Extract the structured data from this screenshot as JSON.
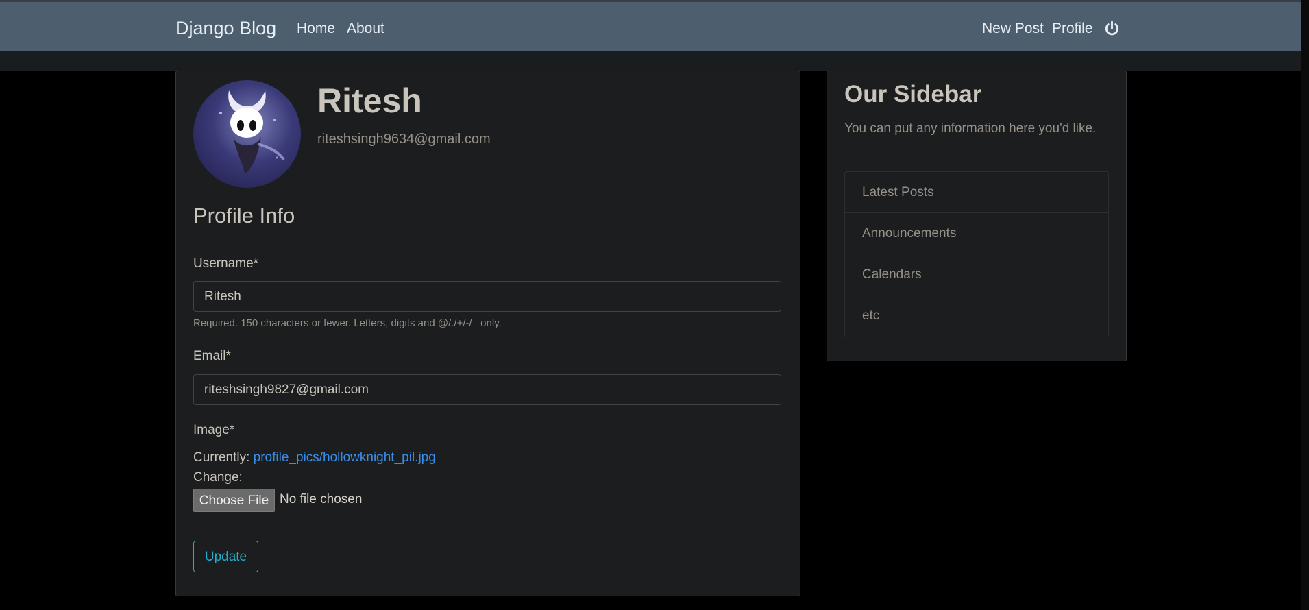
{
  "navbar": {
    "brand": "Django Blog",
    "left_links": [
      "Home",
      "About"
    ],
    "right_links": [
      "New Post",
      "Profile"
    ],
    "logout_icon": "power-icon"
  },
  "profile": {
    "name": "Ritesh",
    "email": "riteshsingh9634@gmail.com",
    "avatar_icon": "avatar-image"
  },
  "form": {
    "section_title": "Profile Info",
    "username_label": "Username*",
    "username_value": "Ritesh",
    "username_help": "Required. 150 characters or fewer. Letters, digits and @/./+/-/_ only.",
    "email_label": "Email*",
    "email_value": "riteshsingh9827@gmail.com",
    "image_label": "Image*",
    "currently_label": "Currently:",
    "current_image": "profile_pics/hollowknight_pil.jpg",
    "change_label": "Change:",
    "choose_file_label": "Choose File",
    "no_file_label": "No file chosen",
    "update_label": "Update"
  },
  "sidebar": {
    "title": "Our Sidebar",
    "description": "You can put any information here you'd like.",
    "items": [
      "Latest Posts",
      "Announcements",
      "Calendars",
      "etc"
    ]
  },
  "colors": {
    "navbar": "#4d5f6e",
    "card": "#1b1d1f",
    "link": "#3b8ee8",
    "update_button": "#23aeca"
  }
}
